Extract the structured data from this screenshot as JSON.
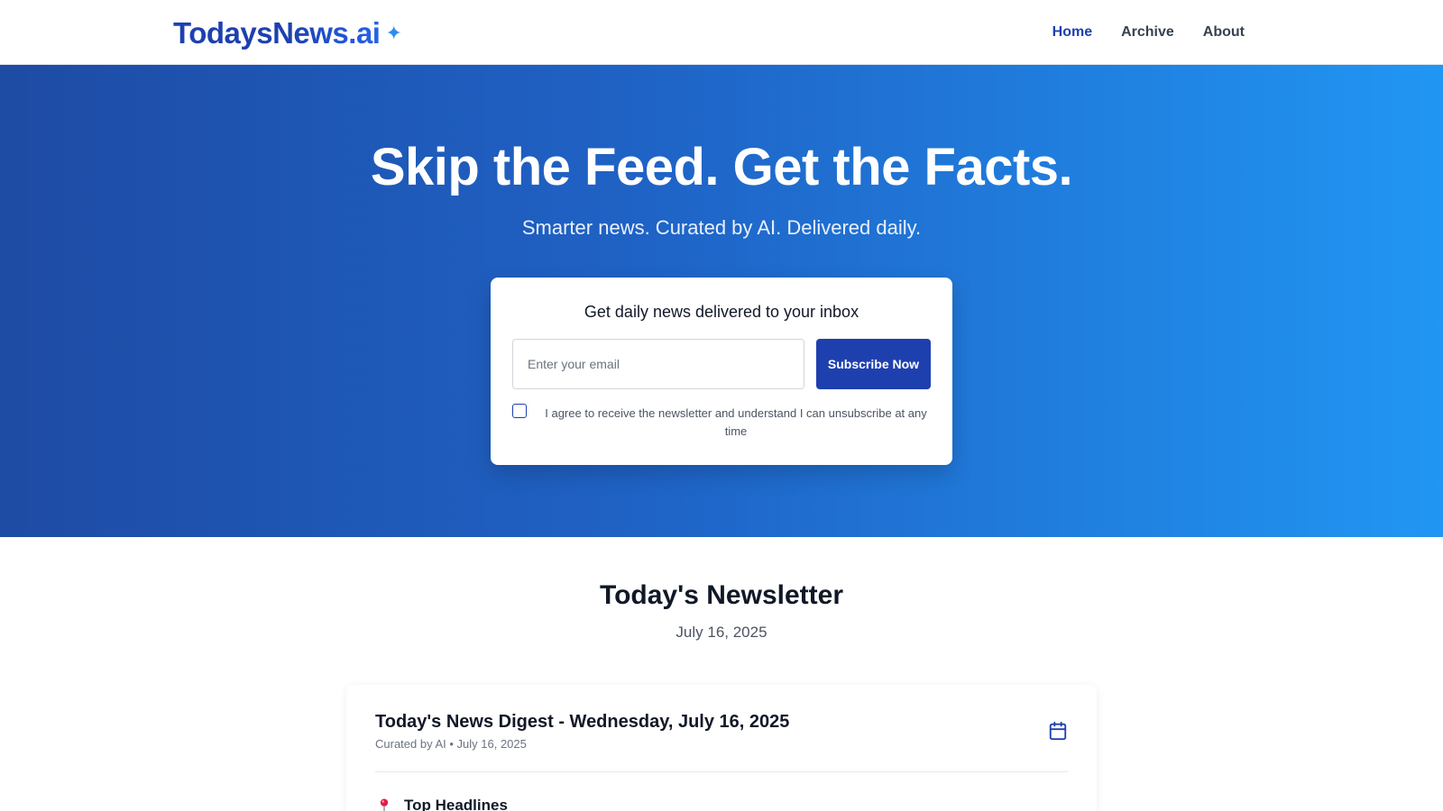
{
  "header": {
    "logo_text": "TodaysNews.ai",
    "logo_star": "✦",
    "nav": [
      {
        "label": "Home",
        "active": true
      },
      {
        "label": "Archive",
        "active": false
      },
      {
        "label": "About",
        "active": false
      }
    ]
  },
  "hero": {
    "title": "Skip the Feed. Get the Facts.",
    "subtitle": "Smarter news. Curated by AI. Delivered daily.",
    "subscribe_card": {
      "title": "Get daily news delivered to your inbox",
      "email_placeholder": "Enter your email",
      "email_value": "",
      "button_label": "Subscribe Now",
      "consent_text": "I agree to receive the newsletter and understand I can unsubscribe at any time",
      "consent_checked": false
    }
  },
  "newsletter": {
    "title": "Today's Newsletter",
    "date": "July 16, 2025",
    "digest": {
      "title": "Today's News Digest - Wednesday, July 16, 2025",
      "meta": "Curated by AI • July 16, 2025",
      "icon": "calendar-icon",
      "first_section": {
        "icon": "pin-icon",
        "label": "Top Headlines"
      }
    }
  },
  "colors": {
    "brand": "#1e40af",
    "hero_gradient_start": "#1e4ba4",
    "hero_gradient_end": "#2196f3",
    "text_dark": "#111827",
    "text_muted": "#6b7280"
  }
}
